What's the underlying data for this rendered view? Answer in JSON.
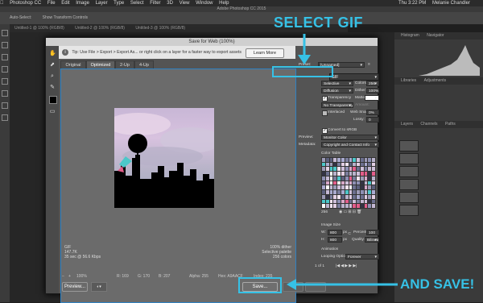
{
  "menubar": {
    "app_name": "Photoshop CC",
    "items": [
      "File",
      "Edit",
      "Image",
      "Layer",
      "Type",
      "Select",
      "Filter",
      "3D",
      "View",
      "Window",
      "Help"
    ],
    "clock": "Thu 3:22 PM",
    "user": "Melanie Chandler"
  },
  "ps_window_title": "Adobe Photoshop CC 2015",
  "ps_options": [
    "Auto-Select:",
    "Show Transform Controls"
  ],
  "ps_tabs": [
    "Untitled-1 @ 100% (RGB/8)",
    "Untitled-2 @ 100% (RGB/8)",
    "Untitled-3 @ 100% (RGB/8)"
  ],
  "right_panel": {
    "tabs_top": [
      "Histogram",
      "Navigator"
    ],
    "tabs_mid": [
      "Libraries",
      "Adjustments"
    ],
    "tabs_low": [
      "Layers",
      "Channels",
      "Paths"
    ],
    "tabs_bottom": [
      "Timeline"
    ]
  },
  "dialog": {
    "title": "Save for Web (100%)",
    "tip": "Tip: Use File > Export > Export As... or right click on a layer for a faster way to export assets",
    "learn_more": "Learn More",
    "view_tabs": [
      "Original",
      "Optimized",
      "2-Up",
      "4-Up"
    ],
    "preview_info_left": [
      "GIF",
      "147.7K",
      "35 sec @ 56.6 Kbps"
    ],
    "preview_info_right": [
      "100% dither",
      "Selective palette",
      "256 colors"
    ],
    "status": {
      "zoom": "100%",
      "r": "R: 169",
      "g": "G: 170",
      "b": "B: 207",
      "alpha": "Alpha: 255",
      "hex": "Hex: A9AACF",
      "index": "Index: 235"
    },
    "buttons": {
      "preview": "Preview...",
      "save": "Save..."
    },
    "settings": {
      "preset_label": "Preset:",
      "preset_value": "[Unnamed]",
      "format": "GIF",
      "reduction": "Selective",
      "colors_label": "Colors:",
      "colors_value": "256",
      "dither_algo": "Diffusion",
      "dither_label": "Dither:",
      "dither_value": "100%",
      "transparency_label": "Transparency",
      "matte_label": "Matte:",
      "transparency_dither": "No Transparency Dit...",
      "amount_label": "Amount:",
      "interlaced_label": "Interlaced",
      "websnap_label": "Web Snap:",
      "websnap_value": "0%",
      "lossy_label": "Lossy:",
      "lossy_value": "0",
      "convert_srgb": "Convert to sRGB",
      "preview_label": "Preview:",
      "preview_value": "Monitor Color",
      "metadata_label": "Metadata:",
      "metadata_value": "Copyright and Contact Info",
      "color_table_label": "Color Table",
      "color_count": "256",
      "image_size_label": "Image Size",
      "w_label": "W:",
      "w_value": "800",
      "h_label": "H:",
      "h_value": "800",
      "px": "px",
      "percent_label": "Percent:",
      "percent_value": "100",
      "quality_label": "Quality:",
      "quality_value": "Bilinear",
      "animation_label": "Animation",
      "looping_label": "Looping Options:",
      "looping_value": "Forever",
      "frame_counter": "1 of 1"
    }
  },
  "callouts": {
    "select_gif": "SELECT GIF",
    "and_save": "AND SAVE!"
  },
  "colors": {
    "accent": "#36c1e6",
    "dialog_bg": "#545454",
    "preview_border": "#2f82c3"
  }
}
